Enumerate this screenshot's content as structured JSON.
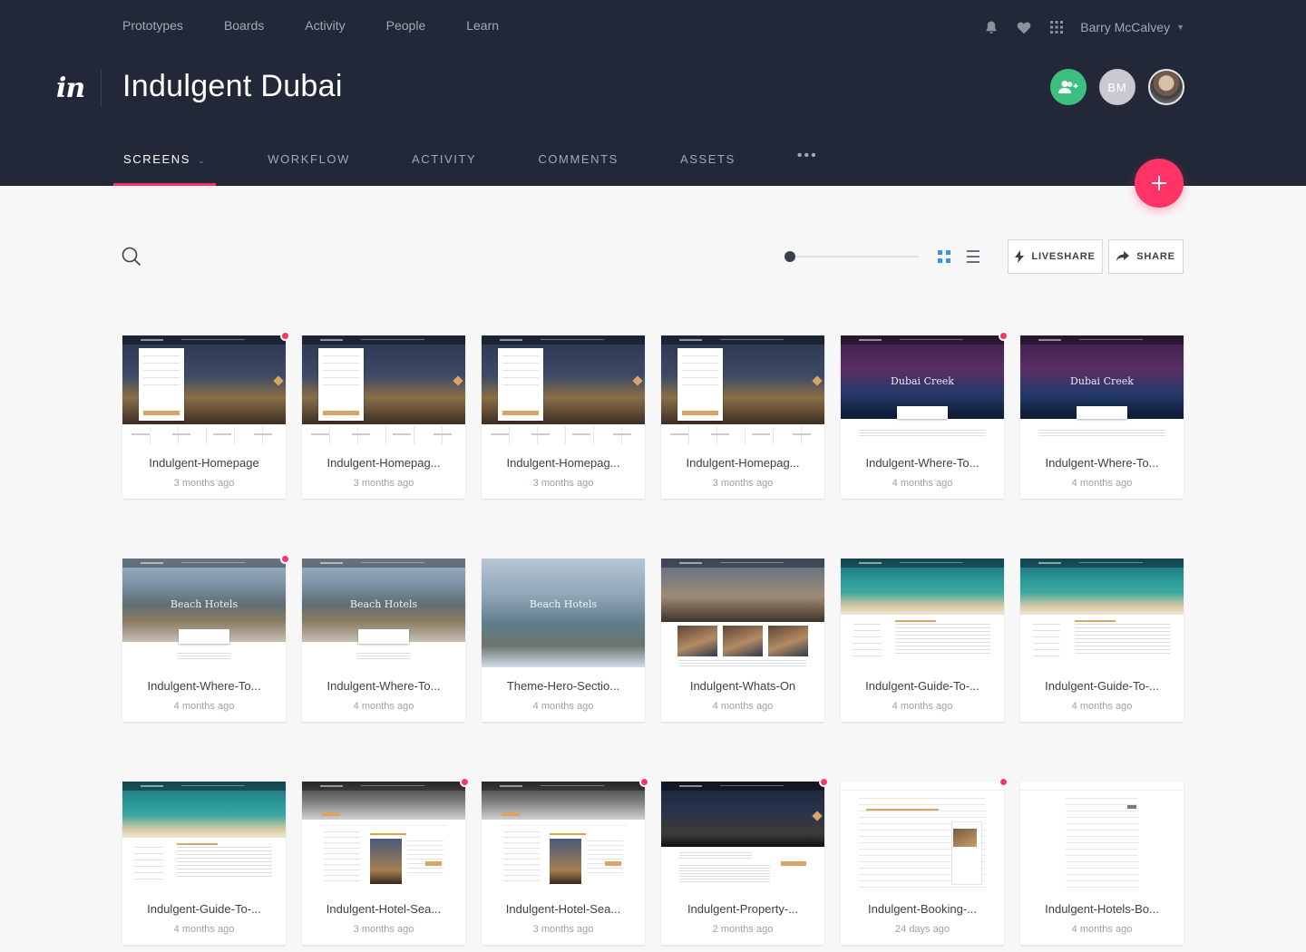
{
  "topnav": [
    "Prototypes",
    "Boards",
    "Activity",
    "People",
    "Learn"
  ],
  "user": {
    "name": "Barry McCalvey",
    "initials": "BM"
  },
  "logo": "in",
  "project_title": "Indulgent Dubai",
  "tabs": [
    {
      "label": "SCREENS",
      "active": true,
      "caret": "⌄"
    },
    {
      "label": "WORKFLOW"
    },
    {
      "label": "ACTIVITY"
    },
    {
      "label": "COMMENTS"
    },
    {
      "label": "ASSETS"
    },
    {
      "label": "•••"
    }
  ],
  "toolbar": {
    "liveshare_label": "LIVESHARE",
    "share_label": "SHARE",
    "view": "grid"
  },
  "colors": {
    "header_bg": "#232838",
    "accent": "#ff3366",
    "add_user": "#3dbf82",
    "grid_active": "#3f8fe8"
  },
  "screens": [
    {
      "name": "Indulgent-Homepage",
      "time": "3 months ago",
      "unread": true,
      "thumb": "homepage"
    },
    {
      "name": "Indulgent-Homepag...",
      "time": "3 months ago",
      "unread": false,
      "thumb": "homepage"
    },
    {
      "name": "Indulgent-Homepag...",
      "time": "3 months ago",
      "unread": false,
      "thumb": "homepage"
    },
    {
      "name": "Indulgent-Homepag...",
      "time": "3 months ago",
      "unread": false,
      "thumb": "homepage"
    },
    {
      "name": "Indulgent-Where-To...",
      "time": "4 months ago",
      "unread": true,
      "thumb": "creek",
      "title": "Dubai Creek"
    },
    {
      "name": "Indulgent-Where-To...",
      "time": "4 months ago",
      "unread": false,
      "thumb": "creek",
      "title": "Dubai Creek"
    },
    {
      "name": "Indulgent-Where-To...",
      "time": "4 months ago",
      "unread": true,
      "thumb": "beach",
      "title": "Beach Hotels"
    },
    {
      "name": "Indulgent-Where-To...",
      "time": "4 months ago",
      "unread": false,
      "thumb": "beach",
      "title": "Beach Hotels"
    },
    {
      "name": "Theme-Hero-Sectio...",
      "time": "4 months ago",
      "unread": false,
      "thumb": "hero",
      "title": "Beach Hotels"
    },
    {
      "name": "Indulgent-Whats-On",
      "time": "4 months ago",
      "unread": false,
      "thumb": "whatson"
    },
    {
      "name": "Indulgent-Guide-To-...",
      "time": "4 months ago",
      "unread": false,
      "thumb": "guide"
    },
    {
      "name": "Indulgent-Guide-To-...",
      "time": "4 months ago",
      "unread": false,
      "thumb": "guide"
    },
    {
      "name": "Indulgent-Guide-To-...",
      "time": "4 months ago",
      "unread": false,
      "thumb": "guide"
    },
    {
      "name": "Indulgent-Hotel-Sea...",
      "time": "3 months ago",
      "unread": true,
      "thumb": "hotelsearch"
    },
    {
      "name": "Indulgent-Hotel-Sea...",
      "time": "3 months ago",
      "unread": true,
      "thumb": "hotelsearch"
    },
    {
      "name": "Indulgent-Property-...",
      "time": "2 months ago",
      "unread": true,
      "thumb": "property"
    },
    {
      "name": "Indulgent-Booking-...",
      "time": "24 days ago",
      "unread": true,
      "thumb": "booking"
    },
    {
      "name": "Indulgent-Hotels-Bo...",
      "time": "4 months ago",
      "unread": false,
      "thumb": "hotelsbo"
    }
  ]
}
